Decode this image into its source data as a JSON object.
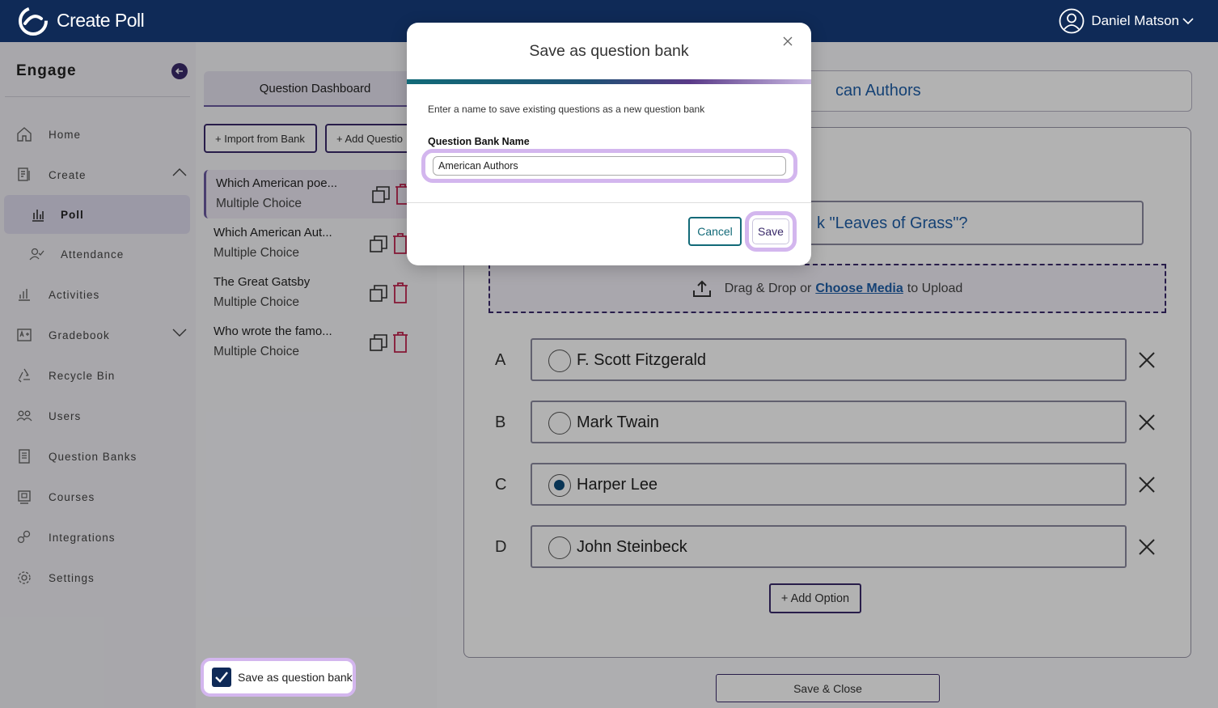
{
  "header": {
    "app_title": "Create Poll",
    "user_name": "Daniel Matson"
  },
  "sidebar": {
    "title": "Engage",
    "items": [
      {
        "label": "Home",
        "icon": "home-icon"
      },
      {
        "label": "Create",
        "icon": "create-icon"
      },
      {
        "label": "Poll",
        "icon": "poll-icon"
      },
      {
        "label": "Attendance",
        "icon": "attendance-icon"
      },
      {
        "label": "Activities",
        "icon": "activities-icon"
      },
      {
        "label": "Gradebook",
        "icon": "gradebook-icon"
      },
      {
        "label": "Recycle Bin",
        "icon": "recycle-icon"
      },
      {
        "label": "Users",
        "icon": "users-icon"
      },
      {
        "label": "Question Banks",
        "icon": "question-banks-icon"
      },
      {
        "label": "Courses",
        "icon": "courses-icon"
      },
      {
        "label": "Integrations",
        "icon": "integrations-icon"
      },
      {
        "label": "Settings",
        "icon": "settings-icon"
      }
    ]
  },
  "middle": {
    "tab_label": "Question Dashboard",
    "import_label": "+ Import from Bank",
    "add_label": "+ Add Questio",
    "questions": [
      {
        "title": "Which American poe...",
        "type": "Multiple Choice"
      },
      {
        "title": "Which American Aut...",
        "type": "Multiple Choice"
      },
      {
        "title": "The Great Gatsby",
        "type": "Multiple Choice"
      },
      {
        "title": "Who wrote the famo...",
        "type": "Multiple Choice"
      }
    ],
    "save_bank_label": "Save as question bank"
  },
  "editor": {
    "title_fragment": "can Authors",
    "question_fragment": "k \"Leaves of Grass\"?",
    "drop_text_1": "Drag & Drop or",
    "drop_link": "Choose Media",
    "drop_text_2": "to Upload",
    "options": [
      {
        "letter": "A",
        "text": "F. Scott Fitzgerald",
        "selected": false
      },
      {
        "letter": "B",
        "text": "Mark Twain",
        "selected": false
      },
      {
        "letter": "C",
        "text": "Harper Lee",
        "selected": true
      },
      {
        "letter": "D",
        "text": "John Steinbeck",
        "selected": false
      }
    ],
    "add_option_label": "+ Add Option",
    "save_close_label": "Save & Close"
  },
  "modal": {
    "title": "Save as question bank",
    "description": "Enter a name to save existing questions as a new question bank",
    "field_label": "Question Bank Name",
    "field_value": "American Authors",
    "cancel_label": "Cancel",
    "save_label": "Save"
  },
  "colors": {
    "header_bg": "#0f2a57",
    "accent": "#3a2a6a",
    "highlight": "#d3b6ee",
    "teal": "#126a78"
  }
}
